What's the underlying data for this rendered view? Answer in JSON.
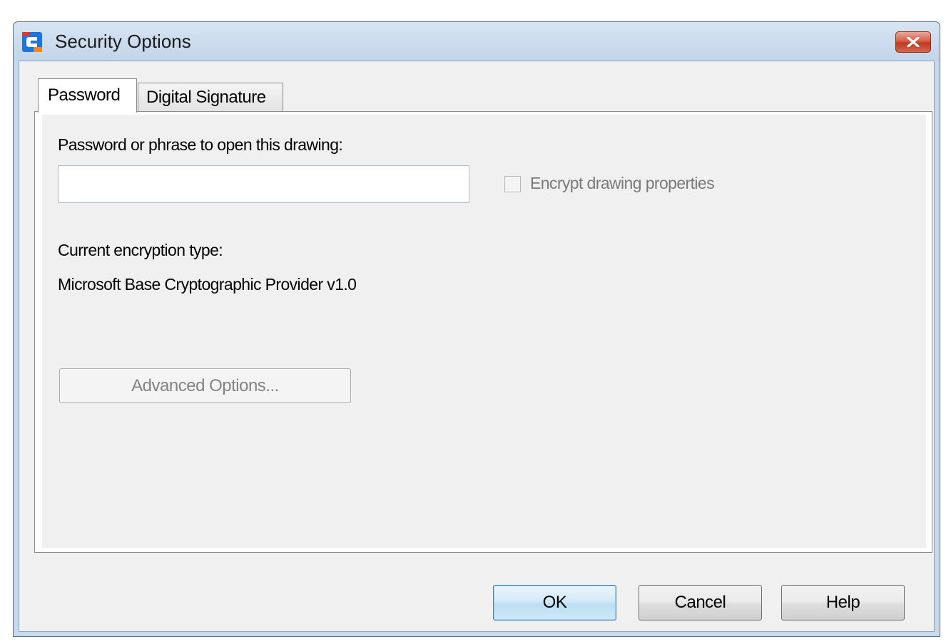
{
  "window": {
    "title": "Security Options",
    "app_icon": "app-logo-icon",
    "close_icon": "close-icon"
  },
  "tabs": [
    {
      "label": "Password",
      "active": true
    },
    {
      "label": "Digital Signature",
      "active": false
    }
  ],
  "password_tab": {
    "password_label": "Password or phrase to open this drawing:",
    "password_value": "",
    "encrypt_properties_label": "Encrypt drawing properties",
    "encrypt_properties_checked": false,
    "encrypt_properties_enabled": false,
    "encryption_type_label": "Current encryption type:",
    "encryption_type_value": "Microsoft Base Cryptographic Provider v1.0",
    "advanced_options_label": "Advanced Options..."
  },
  "buttons": {
    "ok_label": "OK",
    "cancel_label": "Cancel",
    "help_label": "Help"
  },
  "colors": {
    "title_bar": "#c9d9ec",
    "dialog_background": "#f0f0f0",
    "close_button": "#c03a23",
    "ok_border": "#3c7fb1",
    "disabled_text": "#838383"
  }
}
